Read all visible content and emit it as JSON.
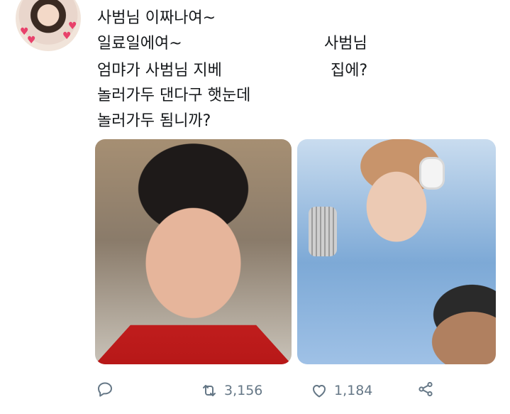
{
  "tweet": {
    "lines": [
      "사범님 이짜나여~",
      "일료일에여~",
      "엄먀가 사범님 지베",
      "놀러가두 댄다구 햇눈데",
      "놀러가두 됨니까?"
    ],
    "annotations": [
      "사범님",
      "집에?"
    ]
  },
  "actions": {
    "reply_icon": "reply-icon",
    "retweet_icon": "retweet-icon",
    "retweet_count": "3,156",
    "like_icon": "heart-icon",
    "like_count": "1,184",
    "share_icon": "share-icon"
  },
  "colors": {
    "text": "#14171a",
    "icon_gray": "#657786",
    "avatar_hearts": "#e8416b"
  }
}
